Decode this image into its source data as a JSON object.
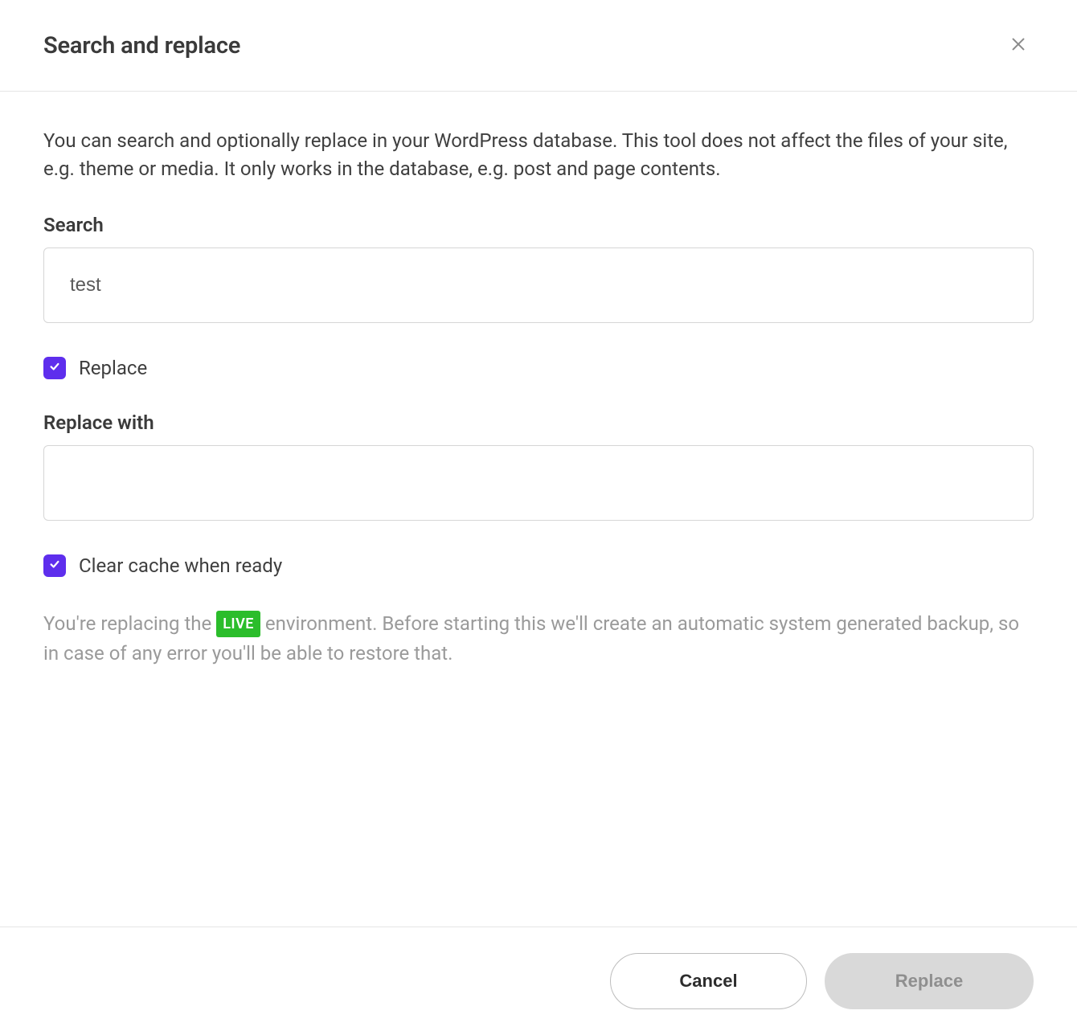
{
  "header": {
    "title": "Search and replace"
  },
  "body": {
    "description": "You can search and optionally replace in your WordPress database. This tool does not affect the files of your site, e.g. theme or media. It only works in the database, e.g. post and page contents.",
    "search_label": "Search",
    "search_value": "test",
    "replace_checkbox_label": "Replace",
    "replace_with_label": "Replace with",
    "replace_with_value": "",
    "clear_cache_label": "Clear cache when ready",
    "note_prefix": "You're replacing the ",
    "note_badge": "LIVE",
    "note_suffix": " environment. Before starting this we'll create an automatic system generated backup, so in case of any error you'll be able to restore that."
  },
  "footer": {
    "cancel_label": "Cancel",
    "replace_label": "Replace"
  }
}
